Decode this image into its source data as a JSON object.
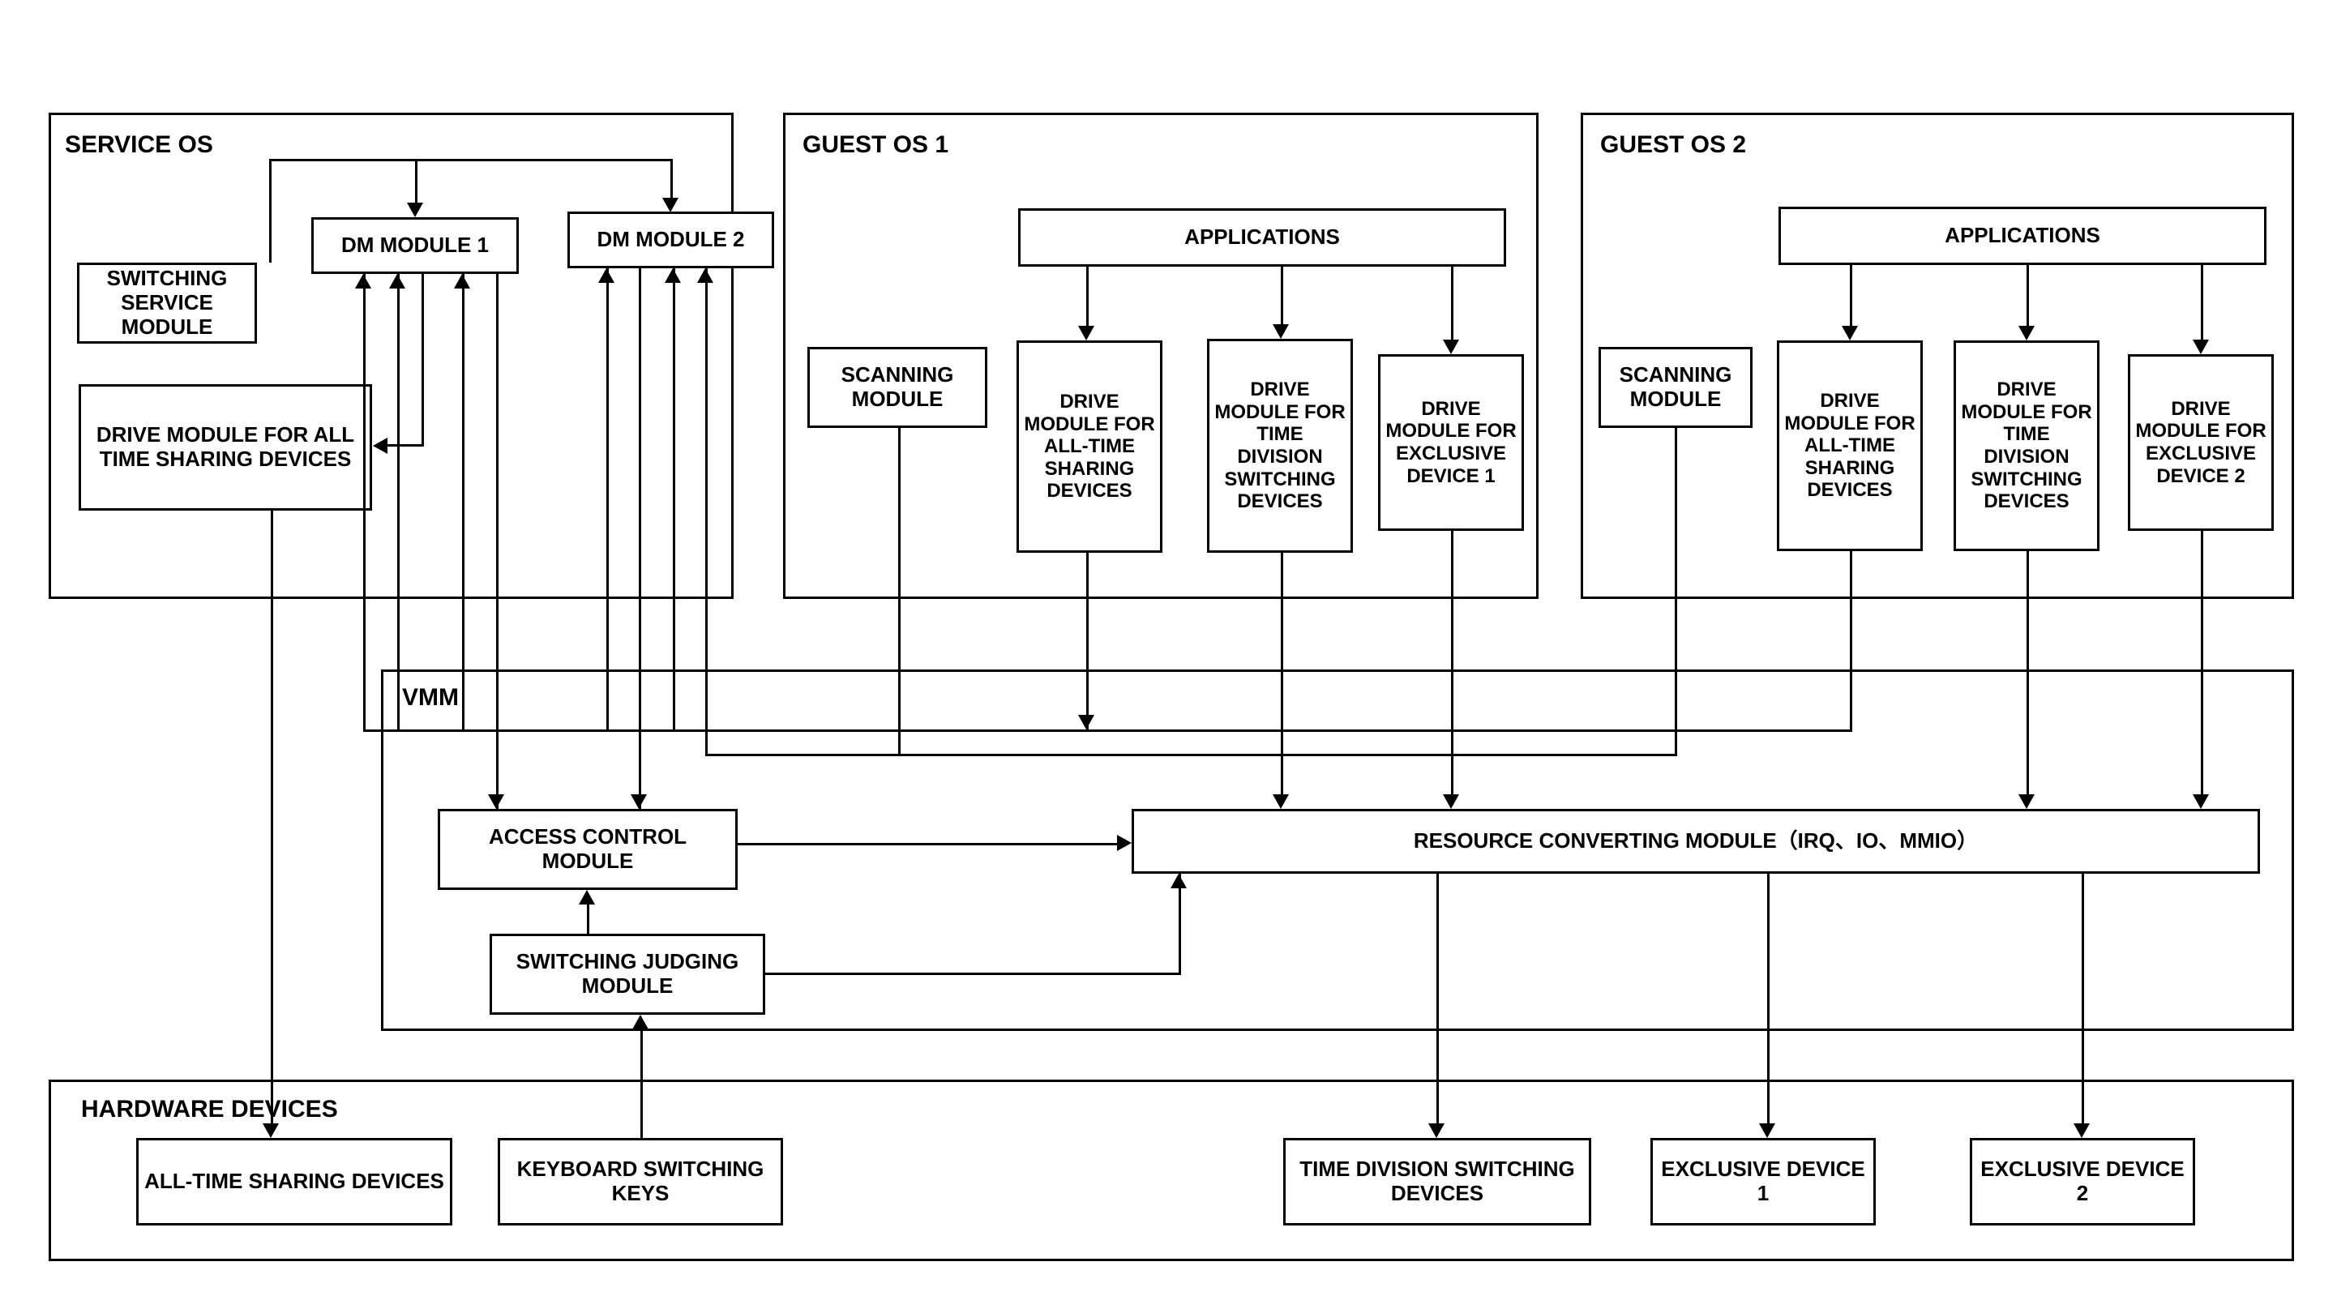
{
  "service_os": {
    "title": "SERVICE OS",
    "dm_module_1": "DM MODULE 1",
    "dm_module_2": "DM MODULE 2",
    "switching_service_module": "SWITCHING SERVICE MODULE",
    "drive_module_all_time": "DRIVE MODULE FOR ALL TIME SHARING DEVICES"
  },
  "guest_os_1": {
    "title": "GUEST OS 1",
    "applications": "APPLICATIONS",
    "scanning_module": "SCANNING MODULE",
    "drive_all_time": "DRIVE MODULE FOR ALL-TIME SHARING DEVICES",
    "drive_time_div": "DRIVE MODULE FOR TIME DIVISION SWITCHING DEVICES",
    "drive_exclusive": "DRIVE MODULE FOR EXCLUSIVE DEVICE 1"
  },
  "guest_os_2": {
    "title": "GUEST OS 2",
    "applications": "APPLICATIONS",
    "scanning_module": "SCANNING MODULE",
    "drive_all_time": "DRIVE MODULE FOR ALL-TIME SHARING DEVICES",
    "drive_time_div": "DRIVE MODULE FOR TIME DIVISION SWITCHING DEVICES",
    "drive_exclusive": "DRIVE MODULE FOR EXCLUSIVE DEVICE 2"
  },
  "vmm": {
    "title": "VMM",
    "access_control": "ACCESS CONTROL MODULE",
    "switching_judging": "SWITCHING JUDGING MODULE",
    "resource_converting": "RESOURCE CONVERTING MODULE（IRQ、IO、MMIO）"
  },
  "hardware": {
    "title": "HARDWARE DEVICES",
    "all_time_sharing": "ALL-TIME SHARING DEVICES",
    "keyboard_switching": "KEYBOARD SWITCHING KEYS",
    "time_div_switching": "TIME DIVISION SWITCHING DEVICES",
    "exclusive_1": "EXCLUSIVE DEVICE 1",
    "exclusive_2": "EXCLUSIVE DEVICE  2"
  }
}
